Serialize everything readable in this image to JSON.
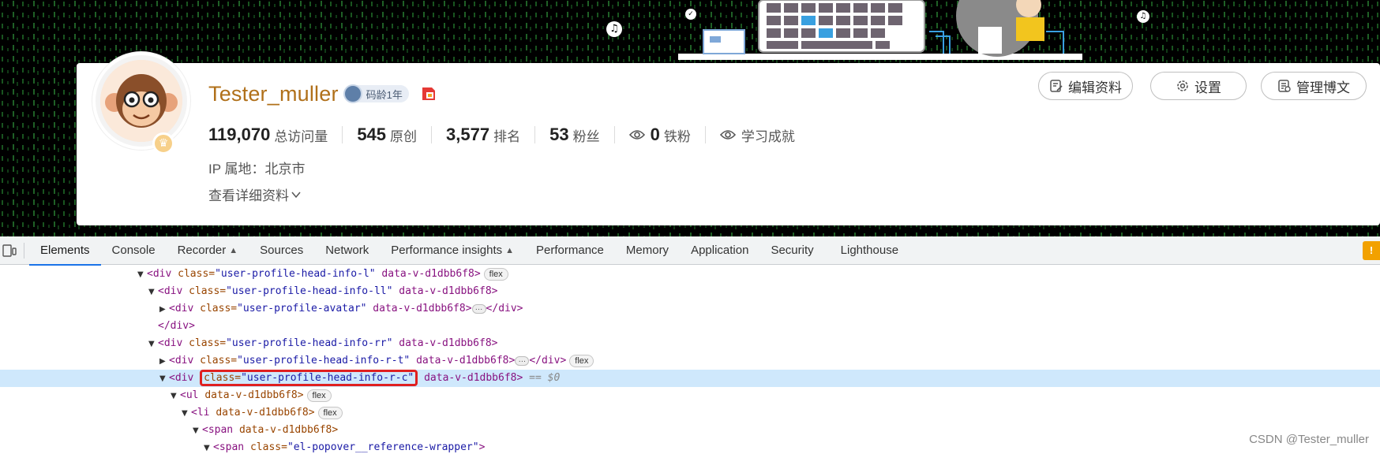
{
  "profile": {
    "username": "Tester_muller",
    "code_age": "码龄1年",
    "stats": [
      {
        "num": "119,070",
        "label": "总访问量"
      },
      {
        "num": "545",
        "label": "原创"
      },
      {
        "num": "3,577",
        "label": "排名"
      },
      {
        "num": "53",
        "label": "粉丝"
      },
      {
        "num": "0",
        "label": "铁粉",
        "icon": "eye-icon"
      },
      {
        "num": "",
        "label": "学习成就",
        "icon": "eye-icon"
      }
    ],
    "ip_location": "IP 属地：北京市",
    "detail_link": "查看详细资料",
    "buttons": {
      "edit": "编辑资料",
      "settings": "设置",
      "manage": "管理博文"
    }
  },
  "devtools": {
    "tabs": [
      "Elements",
      "Console",
      "Recorder",
      "Sources",
      "Network",
      "Performance insights",
      "Performance",
      "Memory",
      "Application",
      "Security",
      "Lighthouse"
    ],
    "active_tab": "Elements",
    "warning_badge": "!",
    "dom": {
      "l1_tag": "<div ",
      "l1_an": "class=",
      "l1_av": "\"user-profile-head-info-l\"",
      "l1_rest": " data-v-d1dbb6f8>",
      "l1_pill": "flex",
      "l2_tag": "<div ",
      "l2_an": "class=",
      "l2_av": "\"user-profile-head-info-ll\"",
      "l2_rest": " data-v-d1dbb6f8>",
      "l3_tag": "<div ",
      "l3_an": "class=",
      "l3_av": "\"user-profile-avatar\"",
      "l3_rest": " data-v-d1dbb6f8>",
      "l3_close": "</div>",
      "l4_close": "</div>",
      "l5_tag": "<div ",
      "l5_an": "class=",
      "l5_av": "\"user-profile-head-info-rr\"",
      "l5_rest": " data-v-d1dbb6f8>",
      "l6_tag": "<div ",
      "l6_an": "class=",
      "l6_av": "\"user-profile-head-info-r-t\"",
      "l6_rest": " data-v-d1dbb6f8>",
      "l6_close": "</div>",
      "l6_pill": "flex",
      "l7_tag": "<div ",
      "l7_an": "class=",
      "l7_av": "\"user-profile-head-info-r-c\"",
      "l7_rest": " data-v-d1dbb6f8>",
      "l7_eq": " == $0",
      "l8_tag": "<ul ",
      "l8_rest": "data-v-d1dbb6f8>",
      "l8_pill": "flex",
      "l9_tag": "<li ",
      "l9_rest": "data-v-d1dbb6f8>",
      "l9_pill": "flex",
      "l10_tag": "<span ",
      "l10_rest": "data-v-d1dbb6f8>",
      "l11_tag": "<span ",
      "l11_an": "class=",
      "l11_av": "\"el-popover__reference-wrapper\"",
      "l11_rest": ">"
    }
  },
  "watermark": "CSDN @Tester_muller",
  "colors": {
    "username": "#b0701a",
    "selected_row": "#cfe8fc",
    "highlight": "#e02020",
    "tab_underline": "#1a73e8"
  }
}
